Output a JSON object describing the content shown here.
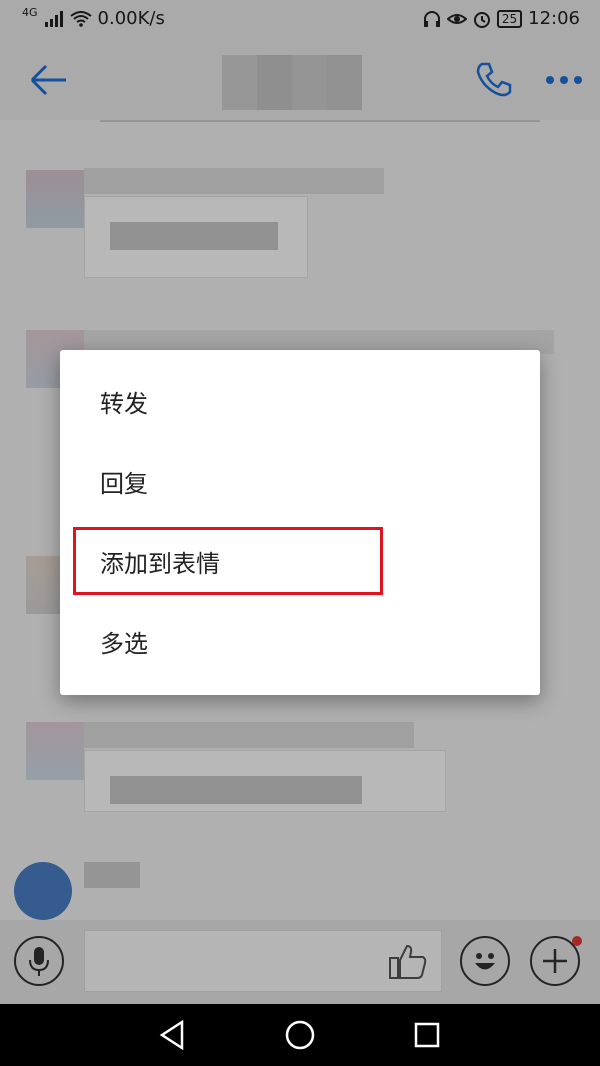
{
  "status_bar": {
    "network_type": "4G",
    "speed": "0.00K/s",
    "battery_level": "25",
    "time": "12:06"
  },
  "app_bar": {
    "back_icon": "arrow-left-icon",
    "call_icon": "phone-icon",
    "more_icon": "more-horizontal-icon",
    "accent_color": "#1e6fd9"
  },
  "context_menu": {
    "items": [
      {
        "label": "转发"
      },
      {
        "label": "回复"
      },
      {
        "label": "添加到表情"
      },
      {
        "label": "多选"
      }
    ],
    "highlighted_item": "添加到表情",
    "highlight_color": "#e0141e"
  },
  "input_bar": {
    "voice_icon": "microphone-icon",
    "like_icon": "thumbs-up-icon",
    "emoji_icon": "smiley-icon",
    "add_icon": "plus-icon",
    "notification_dot_color": "#e53935"
  },
  "nav_bar": {
    "back_icon": "triangle-back-icon",
    "home_icon": "circle-home-icon",
    "recents_icon": "square-recents-icon"
  }
}
